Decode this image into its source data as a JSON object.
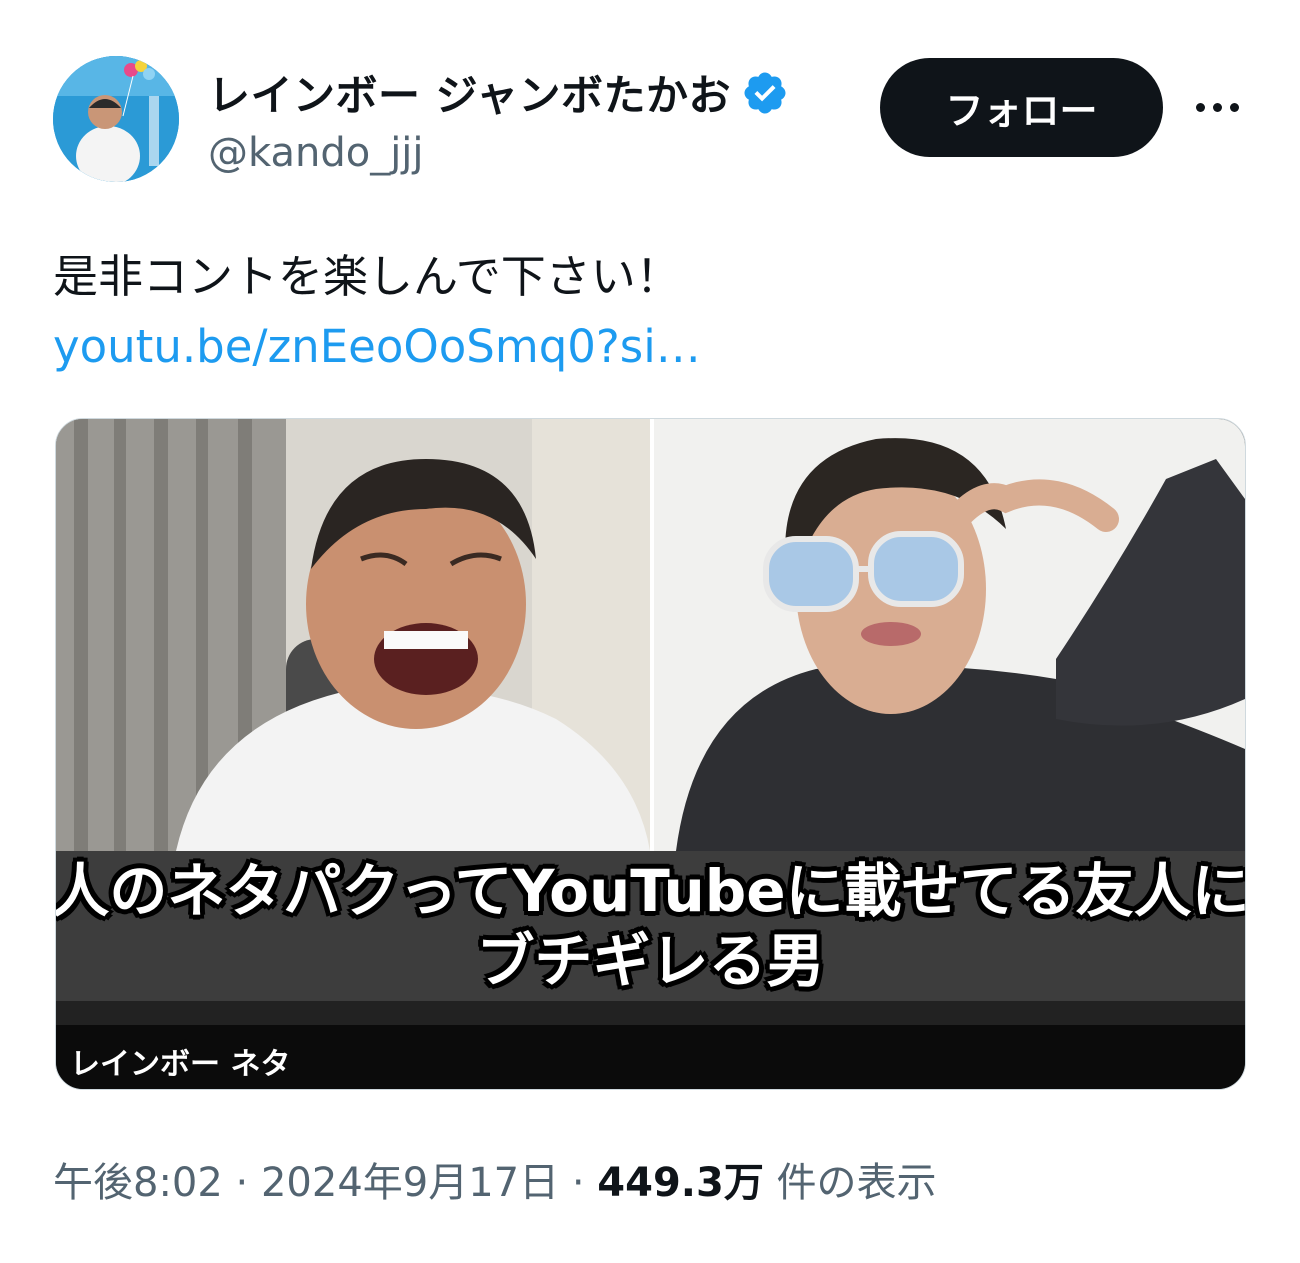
{
  "user": {
    "display_name": "レインボー ジャンボたかお",
    "handle": "@kando_jjj",
    "verified_icon": "verified-badge-icon",
    "avatar_icon": "profile-avatar"
  },
  "actions": {
    "follow_label": "フォロー",
    "more_icon": "more-horizontal-icon"
  },
  "tweet": {
    "text": "是非コントを楽しんで下さい！",
    "link": "youtu.be/znEeoOoSmq0?si…"
  },
  "media": {
    "caption_line1": "人のネタパクってYouTubeに載せてる友人に",
    "caption_line2": "ブチギレる男",
    "channel_label": "レインボー ネタ"
  },
  "meta": {
    "time": "午後8:02",
    "sep1": " · ",
    "date": "2024年9月17日",
    "sep2": " · ",
    "views": "449.3万",
    "views_suffix": " 件の表示"
  },
  "colors": {
    "link": "#1d9bf0",
    "secondary_text": "#536471",
    "follow_bg": "#0f1419",
    "verified": "#1d9bf0"
  }
}
